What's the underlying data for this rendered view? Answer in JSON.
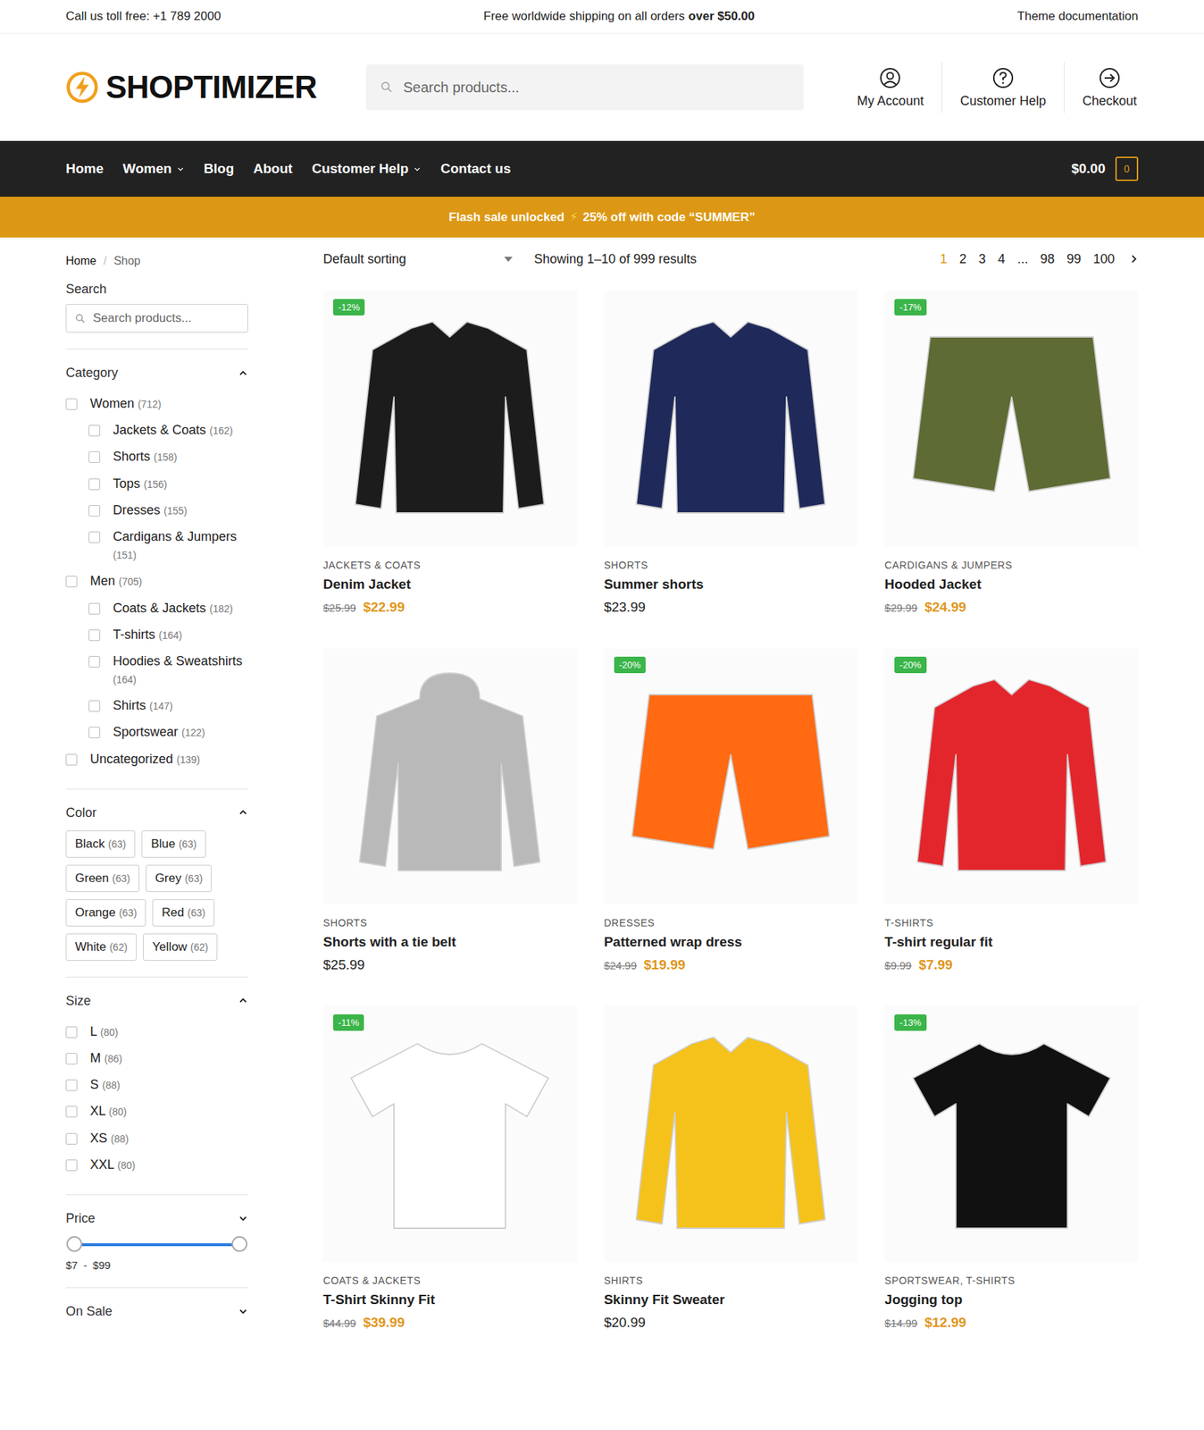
{
  "topbar": {
    "phone": "Call us toll free: +1 789 2000",
    "shipping_text": "Free worldwide shipping on all orders",
    "shipping_bold": "over $50.00",
    "docs": "Theme documentation"
  },
  "header": {
    "logo": "SHOPTIMIZER",
    "search": {
      "placeholder": "Search products..."
    },
    "actions": [
      "My Account",
      "Customer Help",
      "Checkout"
    ]
  },
  "nav": {
    "items": [
      {
        "label": "Home",
        "dropdown": false
      },
      {
        "label": "Women",
        "dropdown": true
      },
      {
        "label": "Blog",
        "dropdown": false
      },
      {
        "label": "About",
        "dropdown": false
      },
      {
        "label": "Customer Help",
        "dropdown": true
      },
      {
        "label": "Contact us",
        "dropdown": false
      }
    ],
    "cart_total": "$0.00",
    "cart_count": "0"
  },
  "banner": {
    "text_before": "Flash sale unlocked",
    "icon": "⚡",
    "text_after": "25% off with code “SUMMER”"
  },
  "breadcrumb": {
    "items": [
      "Home",
      "Shop"
    ],
    "separator": "/"
  },
  "sidebar": {
    "search": {
      "title": "Search",
      "placeholder": "Search products..."
    },
    "category": {
      "title": "Category",
      "expanded": true,
      "items": [
        {
          "label": "Women",
          "count": "(712)",
          "checked": false,
          "children": [
            {
              "label": "Jackets & Coats",
              "count": "(162)",
              "checked": false
            },
            {
              "label": "Shorts",
              "count": "(158)",
              "checked": false
            },
            {
              "label": "Tops",
              "count": "(156)",
              "checked": false
            },
            {
              "label": "Dresses",
              "count": "(155)",
              "checked": false
            },
            {
              "label": "Cardigans & Jumpers",
              "count": "(151)",
              "checked": false
            }
          ]
        },
        {
          "label": "Men",
          "count": "(705)",
          "checked": false,
          "children": [
            {
              "label": "Coats & Jackets",
              "count": "(182)",
              "checked": false
            },
            {
              "label": "T-shirts",
              "count": "(164)",
              "checked": false
            },
            {
              "label": "Hoodies & Sweatshirts",
              "count": "(164)",
              "checked": false
            },
            {
              "label": "Shirts",
              "count": "(147)",
              "checked": false
            },
            {
              "label": "Sportswear",
              "count": "(122)",
              "checked": false
            }
          ]
        },
        {
          "label": "Uncategorized",
          "count": "(139)",
          "checked": false,
          "children": []
        }
      ]
    },
    "color": {
      "title": "Color",
      "expanded": true,
      "items": [
        {
          "label": "Black",
          "count": "(63)",
          "selected": false
        },
        {
          "label": "Blue",
          "count": "(63)",
          "selected": false
        },
        {
          "label": "Green",
          "count": "(63)",
          "selected": false
        },
        {
          "label": "Grey",
          "count": "(63)",
          "selected": false
        },
        {
          "label": "Orange",
          "count": "(63)",
          "selected": false
        },
        {
          "label": "Red",
          "count": "(63)",
          "selected": false
        },
        {
          "label": "White",
          "count": "(62)",
          "selected": false
        },
        {
          "label": "Yellow",
          "count": "(62)",
          "selected": false
        }
      ]
    },
    "size": {
      "title": "Size",
      "expanded": true,
      "items": [
        {
          "label": "L",
          "count": "(80)",
          "checked": false
        },
        {
          "label": "M",
          "count": "(86)",
          "checked": false
        },
        {
          "label": "S",
          "count": "(88)",
          "checked": false
        },
        {
          "label": "XL",
          "count": "(80)",
          "checked": false
        },
        {
          "label": "XS",
          "count": "(88)",
          "checked": false
        },
        {
          "label": "XXL",
          "count": "(80)",
          "checked": false
        }
      ]
    },
    "price": {
      "title": "Price",
      "expanded": false,
      "low_level": 0,
      "high_level": 1,
      "min": "$7",
      "dash": "-",
      "max": "$99"
    },
    "on_sale": {
      "title": "On Sale",
      "expanded": false
    }
  },
  "toolbar": {
    "sorting": "Default sorting",
    "results": "Showing 1–10 of 999 results",
    "pages": [
      {
        "label": "1",
        "selected": true
      },
      {
        "label": "2",
        "selected": false
      },
      {
        "label": "3",
        "selected": false
      },
      {
        "label": "4",
        "selected": false
      },
      {
        "label": "...",
        "selected": false
      },
      {
        "label": "98",
        "selected": false
      },
      {
        "label": "99",
        "selected": false
      },
      {
        "label": "100",
        "selected": false
      }
    ]
  },
  "products": [
    {
      "badge": "-12%",
      "category": "JACKETS & COATS",
      "name": "Denim Jacket",
      "old_price": "$25.99",
      "price": "$22.99",
      "kind": "jacket",
      "color": "#1c1c1c"
    },
    {
      "badge": null,
      "category": "SHORTS",
      "name": "Summer shorts",
      "old_price": null,
      "price": "$23.99",
      "kind": "shirt",
      "color": "#1f2a5a"
    },
    {
      "badge": "-17%",
      "category": "CARDIGANS & JUMPERS",
      "name": "Hooded Jacket",
      "old_price": "$29.99",
      "price": "$24.99",
      "kind": "shorts",
      "color": "#5e6b34"
    },
    {
      "badge": null,
      "category": "SHORTS",
      "name": "Shorts with a tie belt",
      "old_price": null,
      "price": "$25.99",
      "kind": "hoodie",
      "color": "#b9b9b9"
    },
    {
      "badge": "-20%",
      "category": "DRESSES",
      "name": "Patterned wrap dress",
      "old_price": "$24.99",
      "price": "$19.99",
      "kind": "shorts",
      "color": "#ff6a13"
    },
    {
      "badge": "-20%",
      "category": "T-SHIRTS",
      "name": "T-shirt regular fit",
      "old_price": "$9.99",
      "price": "$7.99",
      "kind": "jacket",
      "color": "#e3262c"
    },
    {
      "badge": "-11%",
      "category": "COATS & JACKETS",
      "name": "T-Shirt Skinny Fit",
      "old_price": "$44.99",
      "price": "$39.99",
      "kind": "tshirt",
      "color": "#ffffff"
    },
    {
      "badge": null,
      "category": "SHIRTS",
      "name": "Skinny Fit Sweater",
      "old_price": null,
      "price": "$20.99",
      "kind": "sweater",
      "color": "#f5c21b"
    },
    {
      "badge": "-13%",
      "category": "SPORTSWEAR, T-SHIRTS",
      "name": "Jogging top",
      "old_price": "$14.99",
      "price": "$12.99",
      "kind": "tshirt",
      "color": "#111111"
    }
  ]
}
